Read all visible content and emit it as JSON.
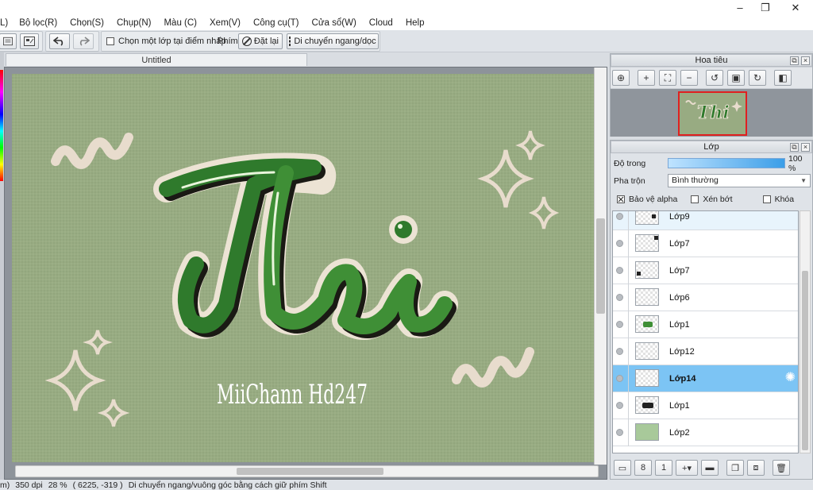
{
  "window": {
    "minimize_glyph": "–",
    "restore_glyph": "❐",
    "close_glyph": "✕"
  },
  "menu": [
    "L)",
    "Bộ lọc(R)",
    "Chọn(S)",
    "Chụp(N)",
    "Màu (C)",
    "Xem(V)",
    "Công cụ(T)",
    "Cửa sổ(W)",
    "Cloud",
    "Help"
  ],
  "toolbar": {
    "select_layer_label": "Chọn một lớp tại điểm nhấp",
    "shortcut_label": "Phím",
    "reset_label": "Đặt lại",
    "move_label": "Di chuyển ngang/dọc"
  },
  "document": {
    "tab_title": "Untitled"
  },
  "artwork": {
    "main_text": "Thi",
    "signature": "MiiChann Hd247",
    "background_color": "#98ab82",
    "lettering_color": "#2f7a2c",
    "outline_color": "#ece3d4"
  },
  "status": {
    "size": "m)",
    "dpi": "350 dpi",
    "zoom": "28 %",
    "coords": "( 6225, -319 )",
    "hint": "Di chuyển ngang/vuông góc bằng cách giữ phím Shift"
  },
  "navigator": {
    "title": "Hoa tiêu",
    "thumb_text": "Thi"
  },
  "layers_panel": {
    "title": "Lớp",
    "opacity_label": "Độ trong",
    "opacity_value": "100 %",
    "opacity_fraction": 1.0,
    "blend_label": "Pha trộn",
    "blend_value": "Bình thường",
    "protect_alpha_label": "Bảo vệ alpha",
    "clipping_label": "Xén bớt",
    "lock_label": "Khóa",
    "layers": [
      {
        "name": "Lớp9",
        "state": "hover"
      },
      {
        "name": "Lớp7",
        "state": "normal"
      },
      {
        "name": "Lớp7",
        "state": "normal"
      },
      {
        "name": "Lớp6",
        "state": "normal"
      },
      {
        "name": "Lớp1",
        "state": "normal"
      },
      {
        "name": "Lớp12",
        "state": "normal"
      },
      {
        "name": "Lớp14",
        "state": "selected"
      },
      {
        "name": "Lớp1",
        "state": "normal"
      },
      {
        "name": "Lớp2",
        "state": "normal"
      }
    ]
  }
}
